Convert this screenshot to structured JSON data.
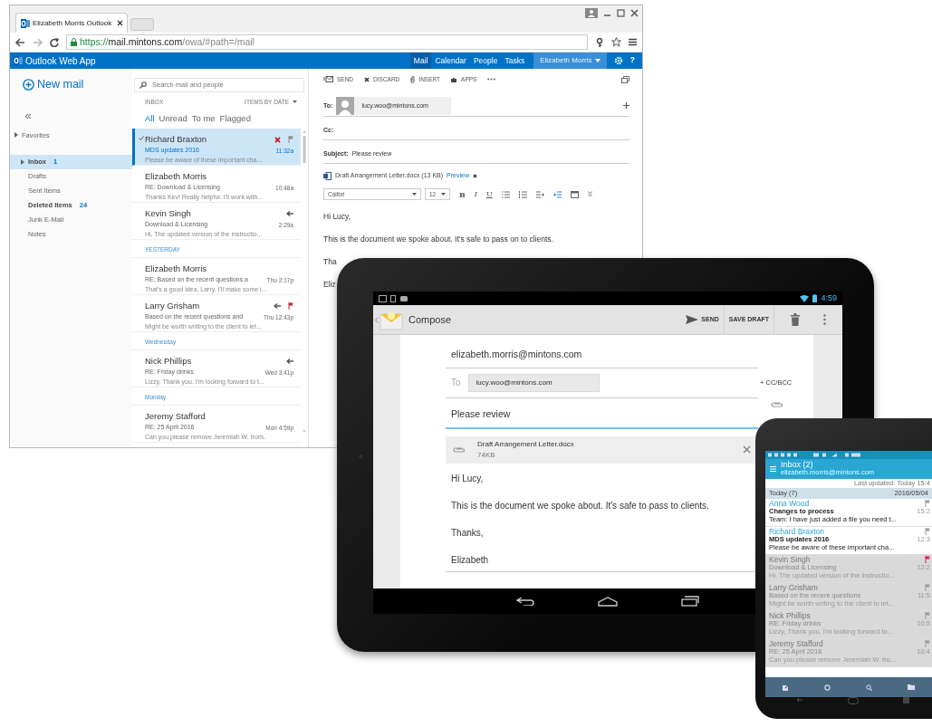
{
  "browser": {
    "tab_title": "Elizabeth Morris  Outlook",
    "url_scheme": "https://",
    "url_host": "mail.mintons.com",
    "url_path": "/owa/#path=/mail",
    "app_name": "Outlook Web App",
    "nav": [
      {
        "label": "Mail",
        "selected": true
      },
      {
        "label": "Calendar",
        "selected": false
      },
      {
        "label": "People",
        "selected": false
      },
      {
        "label": "Tasks",
        "selected": false
      }
    ],
    "user": "Elizabeth Morris",
    "help": "?",
    "new_mail": "New mail",
    "favorites": "Favorites",
    "folders": [
      {
        "label": "Inbox",
        "count": "1",
        "selected": true,
        "bold": true,
        "expandable": true
      },
      {
        "label": "Drafts",
        "selected": false,
        "bold": false,
        "expandable": false
      },
      {
        "label": "Sent Items",
        "selected": false,
        "bold": false,
        "expandable": false
      },
      {
        "label": "Deleted Items",
        "count": "24",
        "selected": false,
        "bold": true,
        "expandable": false
      },
      {
        "label": "Junk E-Mail",
        "selected": false,
        "bold": false,
        "expandable": false
      },
      {
        "label": "Notes",
        "selected": false,
        "bold": false,
        "expandable": false
      }
    ],
    "search": {
      "placeholder": "Search mail and people"
    },
    "list_title": "INBOX",
    "sort": "ITEMS BY DATE",
    "filters": [
      {
        "label": "All",
        "selected": true
      },
      {
        "label": "Unread",
        "selected": false
      },
      {
        "label": "To me",
        "selected": false
      },
      {
        "label": "Flagged",
        "selected": false
      }
    ],
    "messages": [
      {
        "kind": "message",
        "sender": "Richard Braxton",
        "subject": "MDS updates 2016",
        "time": "11:32a",
        "preview": "Please be aware of these important cha...",
        "selected": true,
        "replied": false,
        "flagged": false
      },
      {
        "kind": "message",
        "sender": "Elizabeth Morris",
        "subject": "RE: Download & Licensing",
        "time": "10:48a",
        "preview": "Thanks Kev! Really helpful. I'll work with...",
        "selected": false,
        "replied": false,
        "flagged": false
      },
      {
        "kind": "message",
        "sender": "Kevin Singh",
        "subject": "Download & Licensing",
        "time": "2:29a",
        "preview": "Hi, The updated version of the instructio...",
        "selected": false,
        "replied": true,
        "flagged": false
      },
      {
        "kind": "header",
        "label": "YESTERDAY"
      },
      {
        "kind": "message",
        "sender": "Elizabeth Morris",
        "subject": "RE: Based on the recent questions a",
        "time": "Thu 2:17p",
        "preview": "That's a good idea, Larry. I'll make some i...",
        "selected": false,
        "replied": false,
        "flagged": false
      },
      {
        "kind": "message",
        "sender": "Larry Grisham",
        "subject": "Based on the recent questions and",
        "time": "Thu 12:43p",
        "preview": "Might be worth writing to the client to let...",
        "selected": false,
        "replied": true,
        "flagged": true
      },
      {
        "kind": "header",
        "label": "Wednesday"
      },
      {
        "kind": "message",
        "sender": "Nick Phillips",
        "subject": "RE: Friday drinks",
        "time": "Wed 3:41p",
        "preview": "Lizzy, Thank you. I'm looking forward to t...",
        "selected": false,
        "replied": true,
        "flagged": false
      },
      {
        "kind": "header",
        "label": "Monday"
      },
      {
        "kind": "message",
        "sender": "Jeremy Stafford",
        "subject": "RE: 25 April 2016",
        "time": "Mon 4:59p",
        "preview": "Can you please remove Jeremiah W. from..",
        "selected": false,
        "replied": false,
        "flagged": false
      }
    ],
    "compose": {
      "toolbar": [
        {
          "kind": "send",
          "label": "SEND"
        },
        {
          "kind": "discard",
          "label": "DISCARD"
        },
        {
          "kind": "insert",
          "label": "INSERT"
        },
        {
          "kind": "apps",
          "label": "APPS"
        }
      ],
      "to_label": "To:",
      "to": "lucy.woo@mintons.com",
      "cc_label": "Cc:",
      "subject_label": "Subject:",
      "subject": "Please review",
      "attachment": "Draft Arrangement Letter.docx (13 KB)",
      "preview": "Preview",
      "font": "Calibri",
      "size": "12",
      "format": [
        "B",
        "I",
        "U"
      ],
      "body": [
        "Hi Lucy,",
        "This is the document we spoke about. It's safe to pass on to clients.",
        "Tha",
        "Eliz"
      ]
    }
  },
  "tablet": {
    "time": "4:59",
    "title": "Compose",
    "send": "SEND",
    "save_draft": "SAVE DRAFT",
    "from": "elizabeth.morris@mintons.com",
    "to_label": "To",
    "to": "lucy.woo@mintons.com",
    "cc_bcc": "+ CC/BCC",
    "subject": "Please review",
    "attachment": {
      "name": "Draft Arrangement Letter.docx",
      "size": "74KB"
    },
    "body": [
      "Hi Lucy,",
      "This is the document we spoke about. It's safe to pass to clients.",
      "Thanks,",
      "Elizabeth"
    ]
  },
  "phone": {
    "title": "Inbox (2)",
    "account": "elizabeth.morris@mintons.com",
    "updated": "Last updated: Today 15:4",
    "group": "Today (7)",
    "date": "2016/05/04",
    "messages": [
      {
        "sender": "Anna Wood",
        "subject": "Changes to process",
        "preview": "Team: I have just added a file you need t...",
        "time": "15:2",
        "unread": true,
        "flagged": false
      },
      {
        "sender": "Richard Braxton",
        "subject": "MDS updates 2016",
        "preview": "Please be aware of these important cha...",
        "time": "12:3",
        "unread": true,
        "flagged": false
      },
      {
        "sender": "Kevin Singh",
        "subject": "Download & Licensing",
        "preview": "Hi. The updated version of the instructio...",
        "time": "12:2",
        "unread": false,
        "flagged": true
      },
      {
        "sender": "Larry Grisham",
        "subject": "Based on the recent questions",
        "preview": "Might be worth writing to the client to let...",
        "time": "11:5",
        "unread": false,
        "flagged": false
      },
      {
        "sender": "Nick Phillips",
        "subject": "RE: Friday drinks",
        "preview": "Lizzy, Thank you. I'm looking forward to...",
        "time": "10:5",
        "unread": false,
        "flagged": false
      },
      {
        "sender": "Jeremy Stafford",
        "subject": "RE: 25 April 2016",
        "preview": "Can you please remove Jeremiah W. fro...",
        "time": "10:4",
        "unread": false,
        "flagged": false
      }
    ]
  }
}
